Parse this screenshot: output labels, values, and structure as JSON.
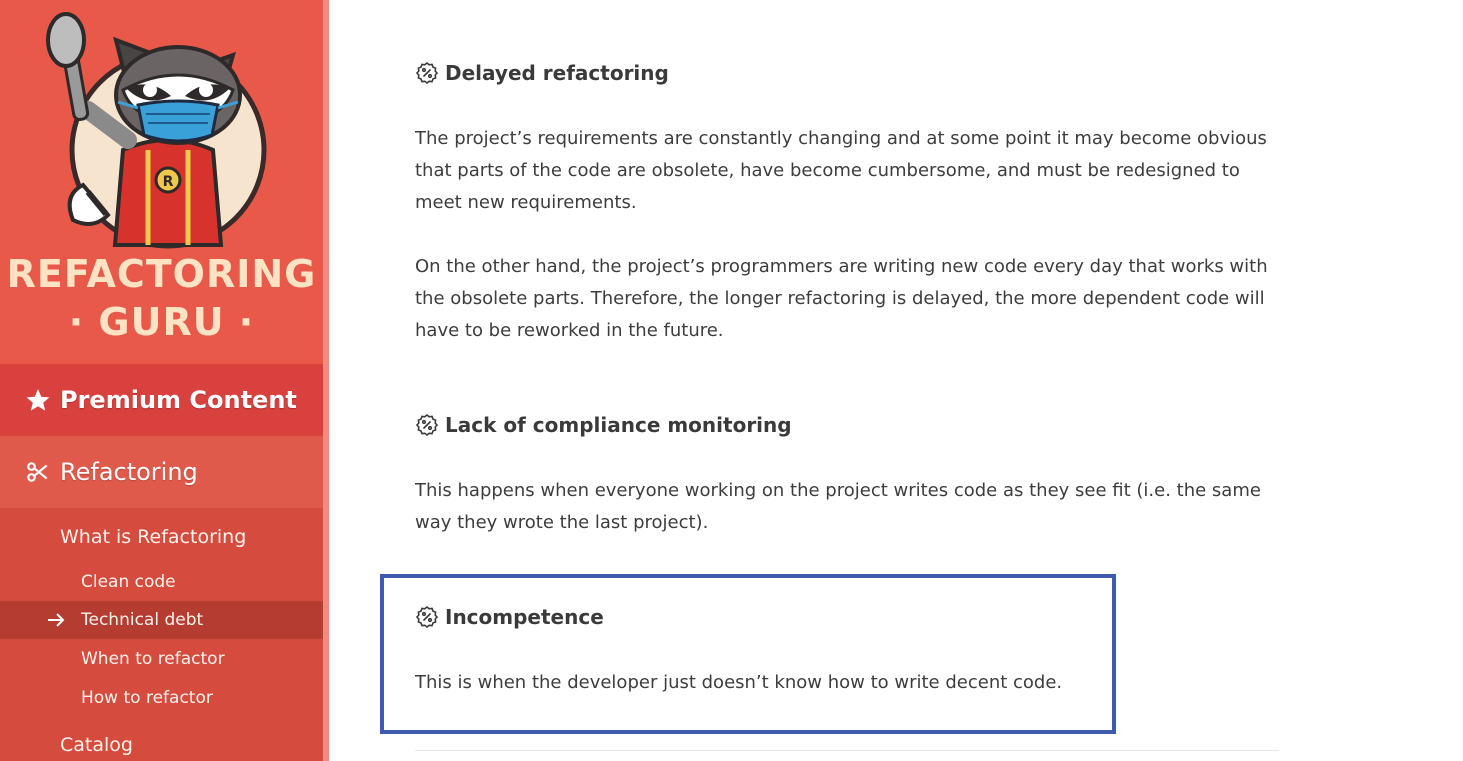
{
  "brand": {
    "line1": "REFACTORING",
    "line2": "· GURU ·",
    "primary_color": "#e8594a",
    "title_color": "#fde3c4"
  },
  "sidebar": {
    "premium": {
      "icon": "star-icon",
      "label": "Premium Content"
    },
    "refactoring": {
      "icon": "scissors-icon",
      "label": "Refactoring"
    },
    "items": [
      {
        "label": "What is Refactoring",
        "level": 1
      },
      {
        "label": "Clean code",
        "level": 2
      },
      {
        "label": "Technical debt",
        "level": 2,
        "active": true
      },
      {
        "label": "When to refactor",
        "level": 2
      },
      {
        "label": "How to refactor",
        "level": 2
      },
      {
        "label": "Catalog",
        "level": 1
      }
    ]
  },
  "article": {
    "sections": [
      {
        "title": "Delayed refactoring",
        "paragraphs": [
          "The project’s requirements are constantly changing and at some point it may become obvious that parts of the code are obsolete, have become cumbersome, and must be redesigned to meet new requirements.",
          "On the other hand, the project’s programmers are writing new code every day that works with the obsolete parts. Therefore, the longer refactoring is delayed, the more dependent code will have to be reworked in the future."
        ]
      },
      {
        "title": "Lack of compliance monitoring",
        "paragraphs": [
          "This happens when everyone working on the project writes code as they see fit (i.e. the same way they wrote the last project)."
        ]
      },
      {
        "title": "Incompetence",
        "paragraphs": [
          "This is when the developer just doesn’t know how to write decent code."
        ]
      }
    ],
    "highlight_color": "#3f5bb0"
  }
}
